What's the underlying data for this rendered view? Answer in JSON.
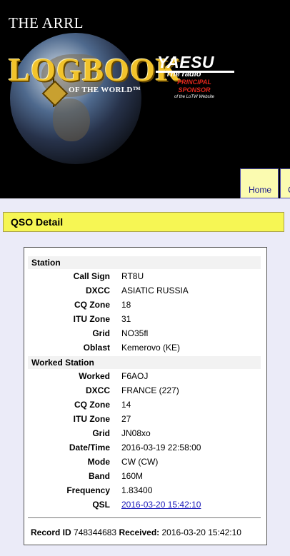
{
  "banner": {
    "title": "THE ARRL",
    "logo_main": "LOGBOOK",
    "logo_sub": "OF THE WORLD™",
    "sponsor_name": "YAESU",
    "sponsor_tagline": "The radio",
    "sponsor_role": "PRINCIPAL SPONSOR",
    "sponsor_note": "of the LoTW Website"
  },
  "nav": {
    "home": "Home",
    "next": "C"
  },
  "page": {
    "title": "QSO Detail"
  },
  "station": {
    "heading": "Station",
    "call_sign_label": "Call Sign",
    "call_sign": "RT8U",
    "dxcc_label": "DXCC",
    "dxcc": "ASIATIC RUSSIA",
    "cq_zone_label": "CQ Zone",
    "cq_zone": "18",
    "itu_zone_label": "ITU Zone",
    "itu_zone": "31",
    "grid_label": "Grid",
    "grid": "NO35fl",
    "oblast_label": "Oblast",
    "oblast": "Kemerovo (KE)"
  },
  "worked": {
    "heading": "Worked Station",
    "worked_label": "Worked",
    "worked": "F6AOJ",
    "dxcc_label": "DXCC",
    "dxcc": "FRANCE (227)",
    "cq_zone_label": "CQ Zone",
    "cq_zone": "14",
    "itu_zone_label": "ITU Zone",
    "itu_zone": "27",
    "grid_label": "Grid",
    "grid": "JN08xo",
    "datetime_label": "Date/Time",
    "datetime": "2016-03-19 22:58:00",
    "mode_label": "Mode",
    "mode": "CW (CW)",
    "band_label": "Band",
    "band": "160M",
    "frequency_label": "Frequency",
    "frequency": "1.83400",
    "qsl_label": "QSL",
    "qsl": "2016-03-20 15:42:10"
  },
  "footer": {
    "record_id_label": "Record ID",
    "record_id": "748344683",
    "received_label": "Received:",
    "received": "2016-03-20 15:42:10"
  },
  "colors": {
    "header_bg": "#f6f654",
    "tab_bg": "#fbfbb0",
    "page_bg": "#ebebf8",
    "link": "#1a1ab8"
  }
}
